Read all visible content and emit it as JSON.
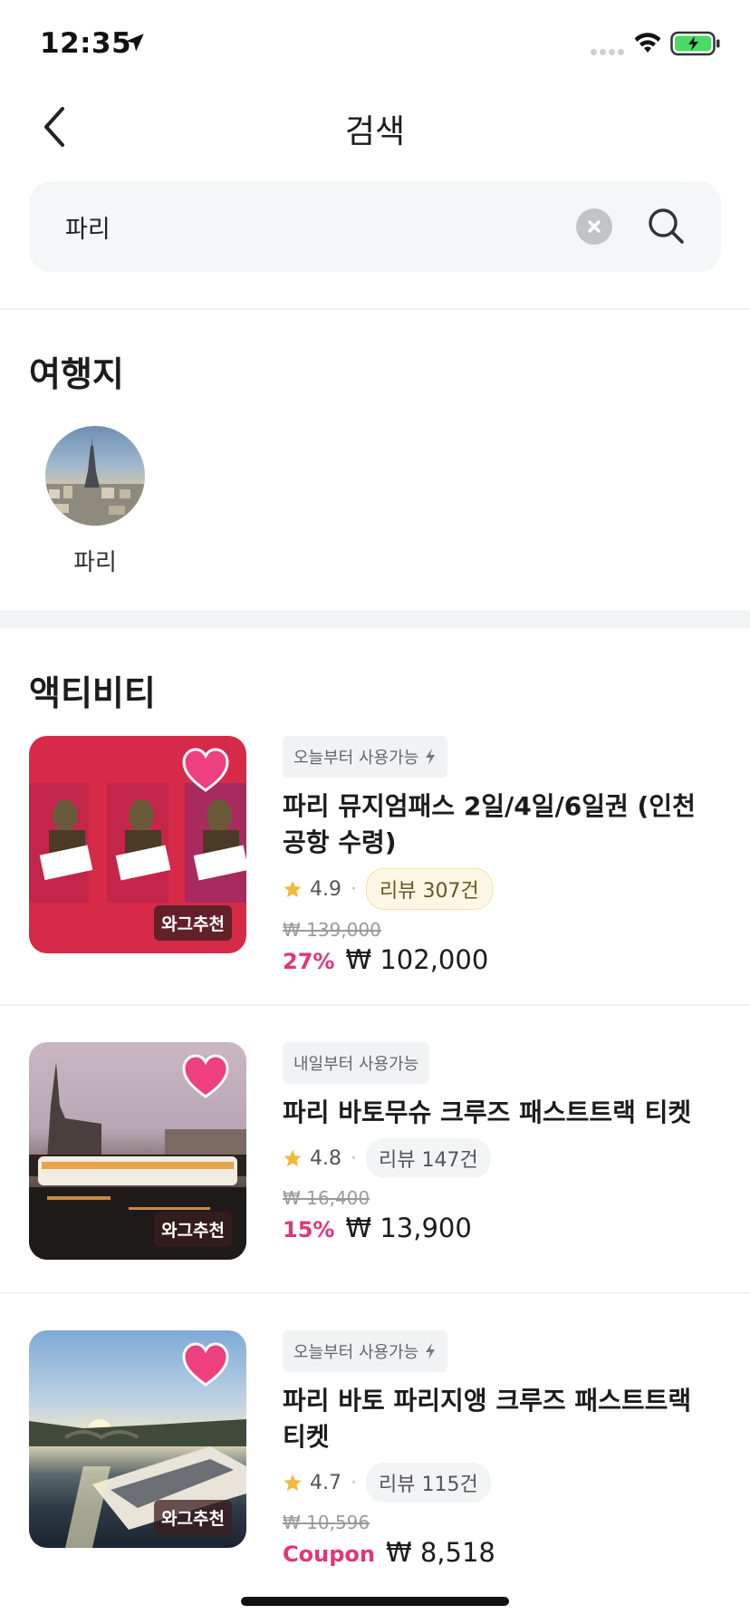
{
  "status_bar": {
    "time": "12:35"
  },
  "header": {
    "title": "검색"
  },
  "search": {
    "value": "파리"
  },
  "destinations": {
    "title": "여행지",
    "items": [
      {
        "label": "파리"
      }
    ]
  },
  "activities": {
    "title": "액티비티",
    "items": [
      {
        "availability": "오늘부터 사용가능",
        "title": "파리 뮤지엄패스 2일/4일/6일권 (인천공항 수령)",
        "rating": "4.9",
        "reviews": "리뷰 307건",
        "original_price": "₩ 139,000",
        "discount": "27%",
        "price": "₩ 102,000",
        "badge": "와그추천",
        "image_theme": "museum-pass",
        "highlight_reviews": true,
        "show_bolt": true
      },
      {
        "availability": "내일부터 사용가능",
        "title": "파리 바토무슈 크루즈 패스트트랙 티켓",
        "rating": "4.8",
        "reviews": "리뷰 147건",
        "original_price": "₩ 16,400",
        "discount": "15%",
        "price": "₩ 13,900",
        "badge": "와그추천",
        "image_theme": "evening-cruise",
        "highlight_reviews": false,
        "show_bolt": false
      },
      {
        "availability": "오늘부터 사용가능",
        "title": "파리 바토 파리지앵 크루즈 패스트트랙 티켓",
        "rating": "4.7",
        "reviews": "리뷰 115건",
        "original_price": "₩ 10,596",
        "discount": "Coupon",
        "price": "₩ 8,518",
        "badge": "와그추천",
        "image_theme": "sunset-cruise",
        "highlight_reviews": false,
        "show_bolt": true
      }
    ]
  },
  "colors": {
    "accent": "#e0367a",
    "heart": "#ee3f7e",
    "star": "#f0b93a",
    "battery": "#4cd964"
  }
}
